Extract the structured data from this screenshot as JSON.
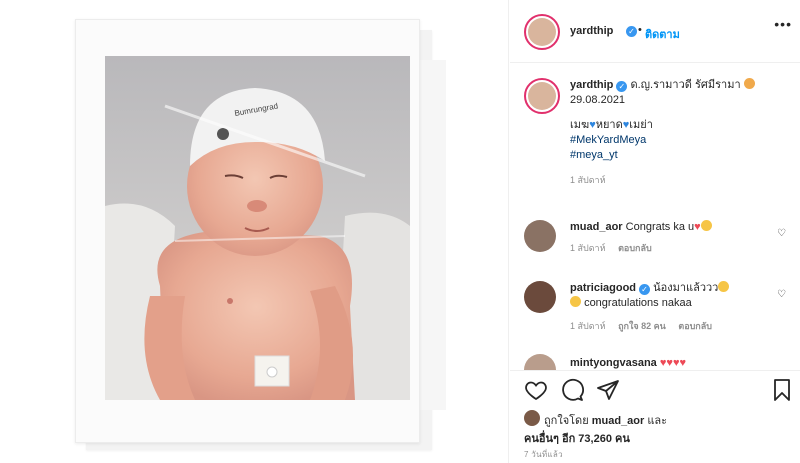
{
  "post": {
    "author": {
      "username": "yardthip",
      "follow_label": "ติดตาม",
      "dot": "•"
    },
    "more_icon": "more-horizontal-icon",
    "caption": {
      "username": "yardthip",
      "name_text": "ด.ญ.รามาวดี รัศมีรามา",
      "date": "29.08.2021",
      "line_a": "เมฆ",
      "line_b": "หยาด",
      "line_c": "เมย่า",
      "hashtag1": "#MekYardMeya",
      "hashtag2": "#meya_yt",
      "age": "1 สัปดาห์"
    },
    "comments": [
      {
        "username": "muad_aor",
        "text": "Congrats ka u",
        "age": "1 สัปดาห์",
        "reply": "ตอบกลับ",
        "likes": ""
      },
      {
        "username": "patriciagood",
        "text": "น้องมาแล้ววว",
        "text2": "congratulations nakaa",
        "age": "1 สัปดาห์",
        "likes": "ถูกใจ 82 คน",
        "reply": "ตอบกลับ"
      },
      {
        "username": "mintyongvasana"
      }
    ],
    "likes_block": {
      "prefix": "ถูกใจโดย",
      "user": "muad_aor",
      "suffix": "และ",
      "others": "คนอื่นๆ อีก 73,260 คน"
    },
    "timestamp": "7 วันที่แล้ว",
    "colors": {
      "accent": "#0095f6",
      "verified": "#3897f0",
      "muted": "#8e8e8e",
      "text": "#262626",
      "heart": "#ed4956"
    },
    "icons": [
      "heart-icon",
      "comment-icon",
      "share-icon",
      "bookmark-icon"
    ]
  }
}
